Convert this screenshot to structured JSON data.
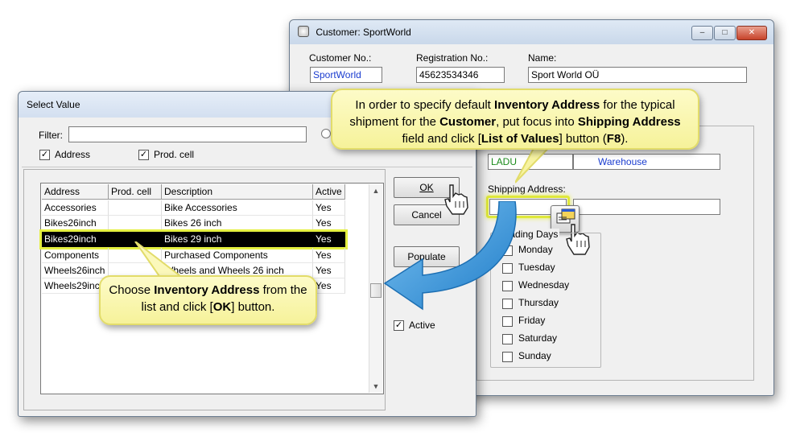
{
  "customer_window": {
    "title": "Customer: SportWorld",
    "customer_no_label": "Customer No.:",
    "customer_no_value": "SportWorld",
    "registration_no_label": "Registration No.:",
    "registration_no_value": "45623534346",
    "name_label": "Name:",
    "name_value": "Sport World OÜ",
    "location_code": "LADU",
    "location_name": "Warehouse",
    "shipping_address_label": "Shipping Address:",
    "shipping_address_value": "",
    "shipping_address_desc": "",
    "loading_days_label": "Loading Days",
    "days": [
      "Monday",
      "Tuesday",
      "Wednesday",
      "Thursday",
      "Friday",
      "Saturday",
      "Sunday"
    ],
    "caption_buttons": {
      "minimize": "–",
      "maximize": "□",
      "close": "✕"
    }
  },
  "select_window": {
    "title": "Select Value",
    "filter_label": "Filter:",
    "filter_value": "",
    "address_check_label": "Address",
    "prodcell_check_label": "Prod. cell",
    "columns": [
      "Address",
      "Prod. cell",
      "Description",
      "Active"
    ],
    "rows": [
      {
        "address": "Accessories",
        "prodcell": "",
        "description": "Bike Accessories",
        "active": "Yes"
      },
      {
        "address": "Bikes26inch",
        "prodcell": "",
        "description": "Bikes 26 inch",
        "active": "Yes"
      },
      {
        "address": "Bikes29inch",
        "prodcell": "",
        "description": "Bikes 29 inch",
        "active": "Yes"
      },
      {
        "address": "Components",
        "prodcell": "",
        "description": "Purchased Components",
        "active": "Yes"
      },
      {
        "address": "Wheels26inch",
        "prodcell": "",
        "description": "Wheels and Wheels 26 inch",
        "active": "Yes"
      },
      {
        "address": "Wheels29inch",
        "prodcell": "",
        "description": "",
        "active": "Yes"
      }
    ],
    "ok_label": "OK",
    "cancel_label": "Cancel",
    "populate_label": "Populate",
    "active_label": "Active"
  },
  "callouts": {
    "top_plain1": "In order to specify default ",
    "top_bold1": "Inventory Address",
    "top_plain2": " for the typical shipment for the ",
    "top_bold2": "Customer",
    "top_plain3": ", put focus into ",
    "top_bold3": "Shipping Address",
    "top_plain4": " field and click [",
    "top_bold4": "List of Values",
    "top_plain5": "] button (",
    "top_bold5": "F8",
    "top_plain6": ").",
    "bottom_plain1": "Choose ",
    "bottom_bold1": "Inventory Address",
    "bottom_plain2": " from the list and click [",
    "bottom_bold2": "OK",
    "bottom_plain3": "] button."
  },
  "colors": {
    "callout_fill": "#f9f6b0",
    "highlight": "#e1ea3c",
    "arrow_blue": "#2e8fd8"
  }
}
